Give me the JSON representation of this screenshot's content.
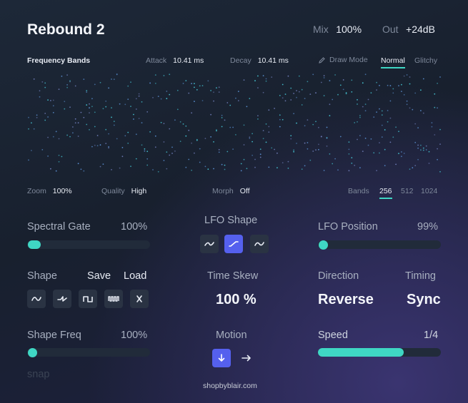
{
  "header": {
    "title": "Rebound 2",
    "mix_label": "Mix",
    "mix_value": "100%",
    "out_label": "Out",
    "out_value": "+24dB"
  },
  "bands_bar": {
    "title": "Frequency Bands",
    "attack_label": "Attack",
    "attack_value": "10.41 ms",
    "decay_label": "Decay",
    "decay_value": "10.41 ms",
    "draw_mode_label": "Draw Mode",
    "modes": [
      "Normal",
      "Glitchy"
    ],
    "selected_mode": "Normal"
  },
  "display_bar": {
    "zoom_label": "Zoom",
    "zoom_value": "100%",
    "quality_label": "Quality",
    "quality_value": "High",
    "morph_label": "Morph",
    "morph_value": "Off",
    "bands_label": "Bands",
    "bands_options": [
      "256",
      "512",
      "1024"
    ],
    "selected_bands": "256"
  },
  "spectral_gate": {
    "label": "Spectral Gate",
    "value": "100%"
  },
  "lfo_shape": {
    "label": "LFO Shape",
    "selected_index": 1
  },
  "lfo_position": {
    "label": "LFO Position",
    "value": "99%",
    "level": 0.0
  },
  "shape": {
    "label": "Shape",
    "save_label": "Save",
    "load_label": "Load"
  },
  "time_skew": {
    "label": "Time Skew",
    "value": "100 %"
  },
  "direction": {
    "label": "Direction",
    "value": "Reverse"
  },
  "timing": {
    "label": "Timing",
    "value": "Sync"
  },
  "shape_freq": {
    "label": "Shape Freq",
    "value": "100%",
    "snap_label": "snap"
  },
  "motion": {
    "label": "Motion",
    "selected": "down"
  },
  "speed": {
    "label": "Speed",
    "value": "1/4",
    "level": 0.7
  },
  "footer": {
    "text": "shopbyblair.com"
  },
  "colors": {
    "accent": "#3fd7c4",
    "button_active": "#5560ee",
    "dot": "#5a8fd0"
  }
}
